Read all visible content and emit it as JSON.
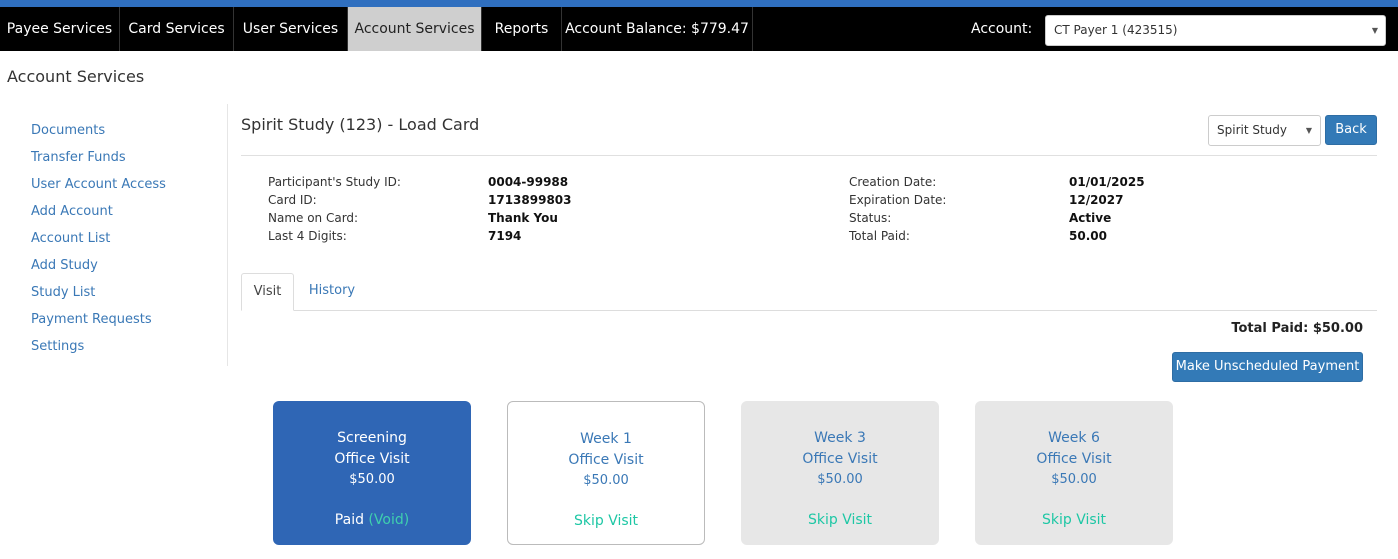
{
  "nav": {
    "items": [
      {
        "label": "Payee Services"
      },
      {
        "label": "Card Services"
      },
      {
        "label": "User Services"
      },
      {
        "label": "Account Services"
      },
      {
        "label": "Reports"
      },
      {
        "label": "Account Balance: $779.47"
      }
    ],
    "active": "Account Services",
    "account_label": "Account:",
    "account_value": "CT Payer 1 (423515)"
  },
  "page_heading": "Account Services",
  "sidebar": {
    "items": [
      {
        "label": "Documents"
      },
      {
        "label": "Transfer Funds"
      },
      {
        "label": "User Account Access"
      },
      {
        "label": "Add Account"
      },
      {
        "label": "Account List"
      },
      {
        "label": "Add Study"
      },
      {
        "label": "Study List"
      },
      {
        "label": "Payment Requests"
      },
      {
        "label": "Settings"
      }
    ]
  },
  "main": {
    "title": "Spirit Study (123) - Load Card",
    "study_select": "Spirit Study",
    "back_label": "Back"
  },
  "info": {
    "left": [
      {
        "label": "Participant's Study ID:",
        "value": "0004-99988"
      },
      {
        "label": "Card ID:",
        "value": "1713899803"
      },
      {
        "label": "Name on Card:",
        "value": "Thank You"
      },
      {
        "label": "Last 4 Digits:",
        "value": "7194"
      }
    ],
    "right": [
      {
        "label": "Creation Date:",
        "value": "01/01/2025"
      },
      {
        "label": "Expiration Date:",
        "value": "12/2027"
      },
      {
        "label": "Status:",
        "value": "Active"
      },
      {
        "label": "Total Paid:",
        "value": "50.00"
      }
    ]
  },
  "tabs": [
    {
      "label": "Visit"
    },
    {
      "label": "History"
    }
  ],
  "total_paid": "Total Paid: $50.00",
  "unscheduled_button": "Make Unscheduled Payment",
  "visits": [
    {
      "name": "Screening",
      "type": "Office Visit",
      "amount": "$50.00",
      "status": "Paid",
      "action": "(Void)"
    },
    {
      "name": "Week 1",
      "type": "Office Visit",
      "amount": "$50.00",
      "action": "Skip Visit"
    },
    {
      "name": "Week 3",
      "type": "Office Visit",
      "amount": "$50.00",
      "action": "Skip Visit"
    },
    {
      "name": "Week 6",
      "type": "Office Visit",
      "amount": "$50.00",
      "action": "Skip Visit"
    }
  ],
  "colors": {
    "nav_bg": "#000000",
    "accent": "#337ab7",
    "paid_card": "#2f66b5",
    "skip_text": "#1ec7a5"
  }
}
